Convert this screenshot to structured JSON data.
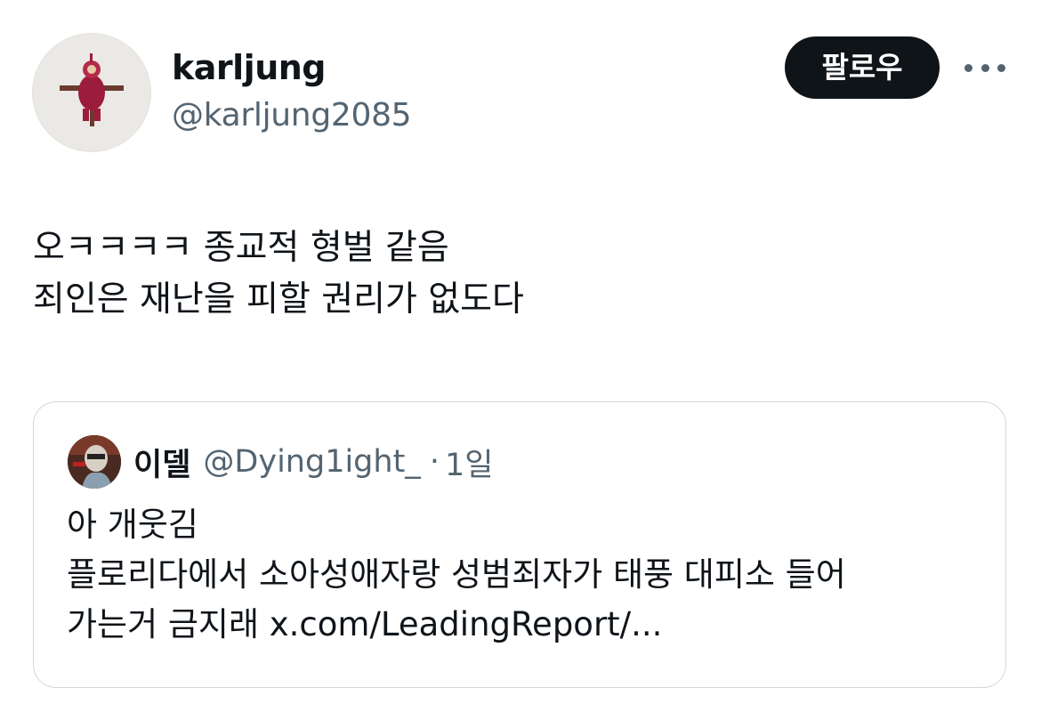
{
  "author": {
    "display_name": "karljung",
    "handle": "@karljung2085"
  },
  "follow_button_label": "팔로우",
  "tweet": {
    "lines": [
      "오ㅋㅋㅋㅋ 종교적 형벌 같음",
      "죄인은 재난을 피할 권리가 없도다"
    ]
  },
  "quoted_tweet": {
    "display_name": "이델",
    "handle": "@Dying1ight_",
    "separator": "·",
    "time": "1일",
    "lines": [
      "아 개웃김",
      "플로리다에서 소아성애자랑 성범죄자가 태풍 대피소 들어",
      "가는거 금지래 x.com/LeadingReport/..."
    ]
  },
  "colors": {
    "text_primary": "#0f1419",
    "text_secondary": "#536471",
    "button_bg": "#0f1419",
    "border": "#cfd9de"
  },
  "icons": {
    "more": "more-horizontal-icon"
  }
}
